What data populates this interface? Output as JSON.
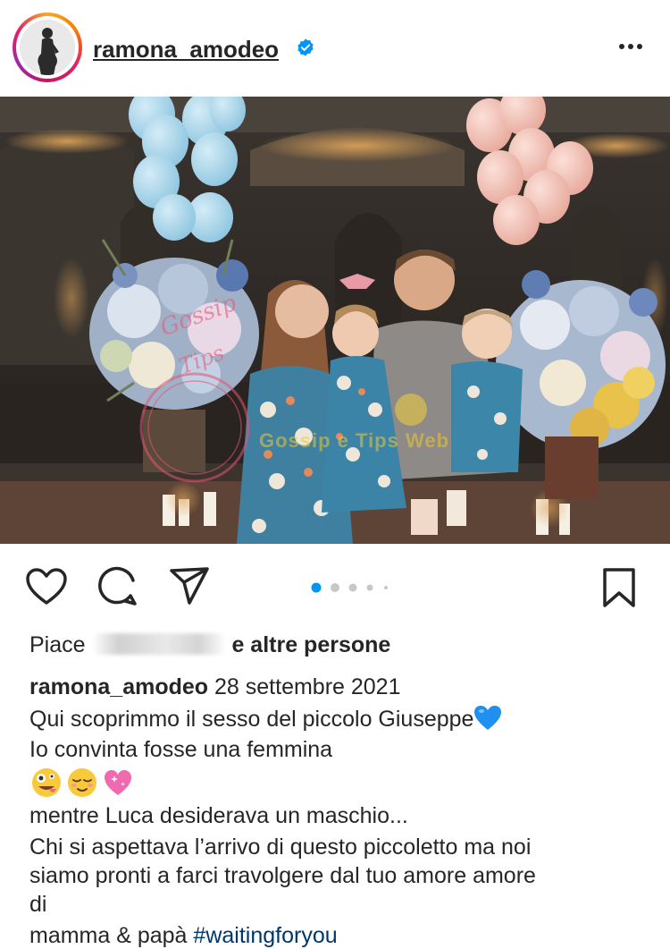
{
  "header": {
    "username": "ramona_amodeo",
    "verified_icon": "verified-badge-icon",
    "more_icon": "more-options-icon"
  },
  "photo": {
    "description_icon": "family-photo",
    "watermark_left_lines": [
      "Gossip",
      "Tips"
    ],
    "watermark_center": "Gossip e Tips Web"
  },
  "actions": {
    "like_icon": "heart-icon",
    "comment_icon": "comment-icon",
    "share_icon": "share-icon",
    "save_icon": "bookmark-icon",
    "carousel_index": 1,
    "carousel_total": 5,
    "accent_color": "#0095f6"
  },
  "likes": {
    "prefix": "Piace",
    "suffix": "e altre persone"
  },
  "caption": {
    "username": "ramona_amodeo",
    "date": "28 settembre 2021",
    "line1": "Qui scoprimmo il sesso del piccolo Giuseppe",
    "heart_emoji": "💙",
    "line2": "Io convinta fosse una femmina",
    "emoji_row": [
      "zany-face-emoji",
      "relieved-face-emoji",
      "sparkling-heart-emoji"
    ],
    "line3": "mentre Luca desiderava un maschio...",
    "line4": "Chi si aspettava l’arrivo di questo piccoletto ma noi",
    "line5": "siamo pronti a farci travolgere dal tuo amore amore",
    "line6": "di",
    "line7_text": "mamma & papà",
    "hashtag": "#waitingforyou"
  },
  "colors": {
    "link": "#00376b",
    "text": "#262626",
    "verified": "#0095f6"
  }
}
